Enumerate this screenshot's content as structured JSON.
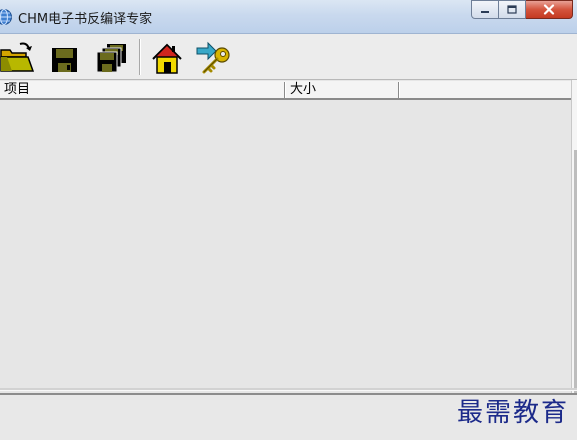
{
  "window": {
    "title": "CHM电子书反编译专家",
    "icon": "globe-icon",
    "controls": [
      "minimize-icon",
      "maximize-icon",
      "close-icon"
    ]
  },
  "toolbar": {
    "buttons": [
      {
        "name": "open",
        "icon": "open-folder-icon"
      },
      {
        "name": "save",
        "icon": "floppy-disk-icon"
      },
      {
        "name": "save-all",
        "icon": "multi-floppy-icon"
      },
      {
        "name": "home",
        "icon": "home-icon"
      },
      {
        "name": "register",
        "icon": "arrow-key-icon"
      }
    ]
  },
  "list": {
    "columns": [
      "项目",
      "大小",
      ""
    ],
    "rows": []
  },
  "watermark": "最需教育",
  "colors": {
    "titlebar": "#c9d9ee",
    "close_button": "#c43a22",
    "toolbar_icon_fill": "#6b6b1e",
    "house_fill": "#f1d900",
    "house_roof": "#d0261e",
    "key_fill": "#d7b400",
    "arrow_fill": "#38a8c8",
    "folder_fill": "#d4a500",
    "watermark": "#1c2a8a"
  }
}
